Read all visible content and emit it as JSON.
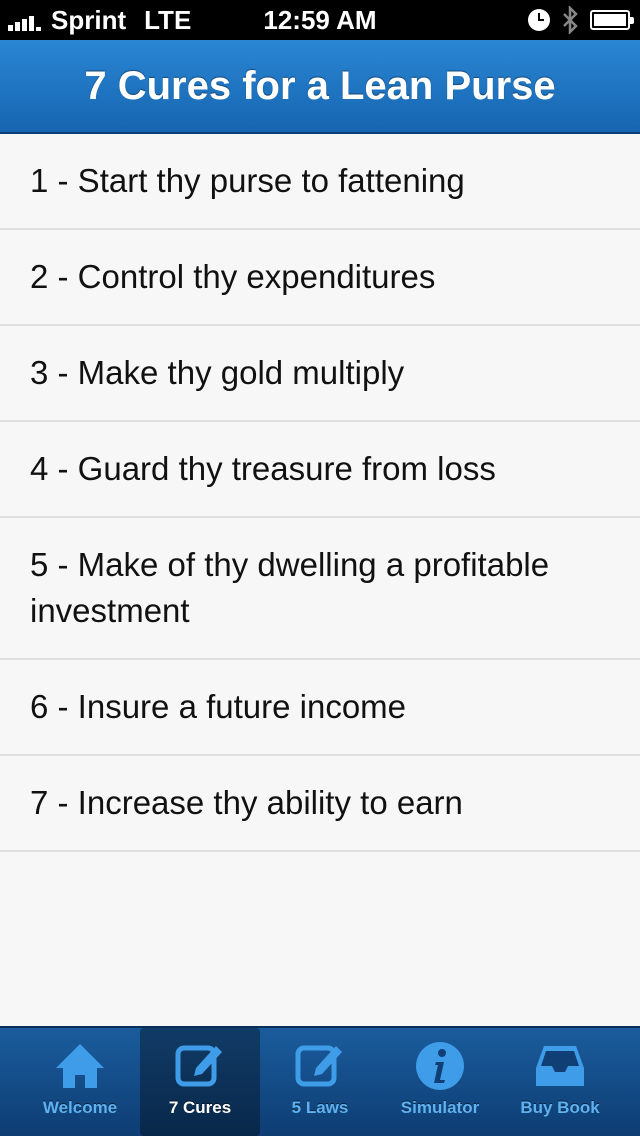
{
  "status_bar": {
    "carrier": "Sprint",
    "network": "LTE",
    "time": "12:59 AM"
  },
  "nav": {
    "title": "7 Cures for a Lean Purse"
  },
  "cures": [
    {
      "label": "1 - Start thy purse to fattening"
    },
    {
      "label": "2 - Control thy expenditures"
    },
    {
      "label": "3 - Make thy gold multiply"
    },
    {
      "label": "4 - Guard thy treasure from loss"
    },
    {
      "label": "5 - Make of thy dwelling a profitable investment"
    },
    {
      "label": "6 - Insure a future income"
    },
    {
      "label": "7 - Increase thy ability to earn"
    }
  ],
  "tabs": [
    {
      "label": "Welcome",
      "icon": "home-icon"
    },
    {
      "label": "7 Cures",
      "icon": "edit-icon",
      "active": true
    },
    {
      "label": "5 Laws",
      "icon": "edit-icon"
    },
    {
      "label": "Simulator",
      "icon": "info-icon"
    },
    {
      "label": "Buy Book",
      "icon": "inbox-icon"
    }
  ],
  "colors": {
    "nav_bar": "#1d74c2",
    "tab_bar": "#12467f",
    "tab_label": "#5fb1f0",
    "tab_icon": "#3f9ce8"
  }
}
